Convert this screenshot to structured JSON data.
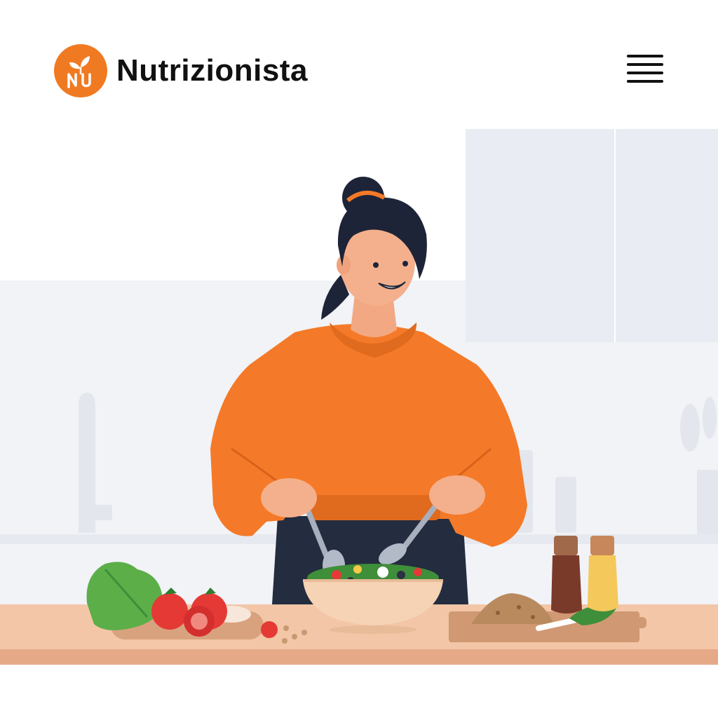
{
  "header": {
    "brand_name": "Nutrizionista",
    "logo": {
      "icon": "leaf-monogram-icon",
      "monogram": "NU",
      "color": "#F07A22"
    },
    "menu_icon": "hamburger-menu-icon"
  },
  "hero": {
    "illustration": "nutritionist-tossing-salad-illustration"
  },
  "colors": {
    "accent": "#F07A22",
    "text": "#111111",
    "counter": "#F2C6A6",
    "background": "#FFFFFF"
  }
}
